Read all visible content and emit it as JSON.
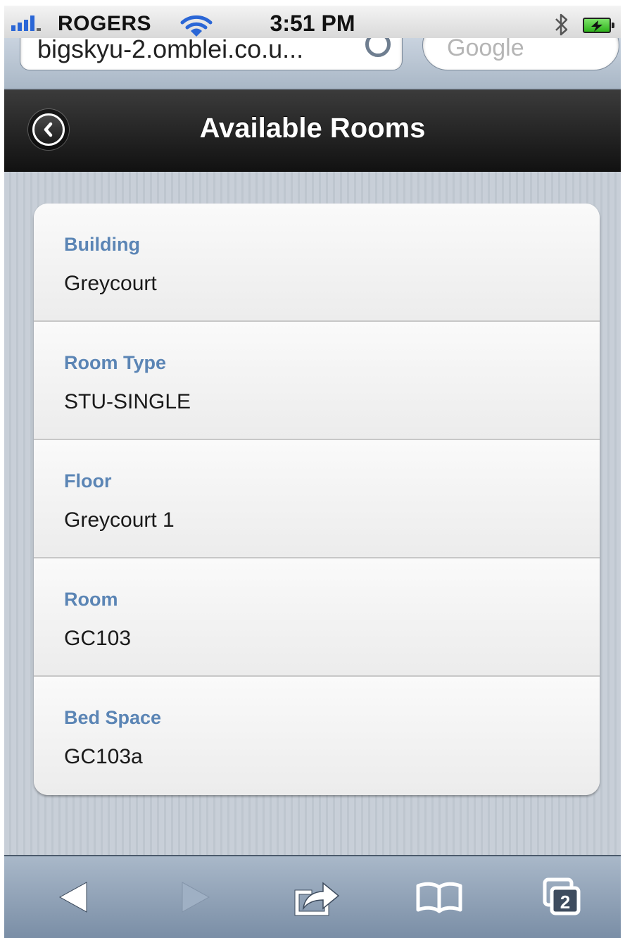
{
  "status_bar": {
    "carrier": "ROGERS",
    "time": "3:51 PM",
    "signal_icon": "signal-bars-icon",
    "wifi_icon": "wifi-icon",
    "bluetooth_icon": "bluetooth-icon",
    "battery_icon": "battery-charging-icon"
  },
  "browser": {
    "address": "bigskyu-2.omblei.co.u...",
    "search_placeholder": "Google"
  },
  "header": {
    "title": "Available Rooms",
    "back_icon": "back-chevron-icon"
  },
  "details": [
    {
      "label": "Building",
      "value": "Greycourt"
    },
    {
      "label": "Room Type",
      "value": "STU-SINGLE"
    },
    {
      "label": "Floor",
      "value": "Greycourt 1"
    },
    {
      "label": "Room",
      "value": "GC103"
    },
    {
      "label": "Bed Space",
      "value": "GC103a"
    }
  ],
  "toolbar": {
    "back_icon": "back-arrow-icon",
    "forward_icon": "forward-arrow-icon",
    "share_icon": "share-icon",
    "bookmarks_icon": "bookmarks-icon",
    "pages_icon": "pages-icon",
    "pages_count": "2"
  },
  "colors": {
    "label": "#5b85b5",
    "header_bg": "#1a1a1a",
    "toolbar_bg": "#8ea0b6"
  }
}
